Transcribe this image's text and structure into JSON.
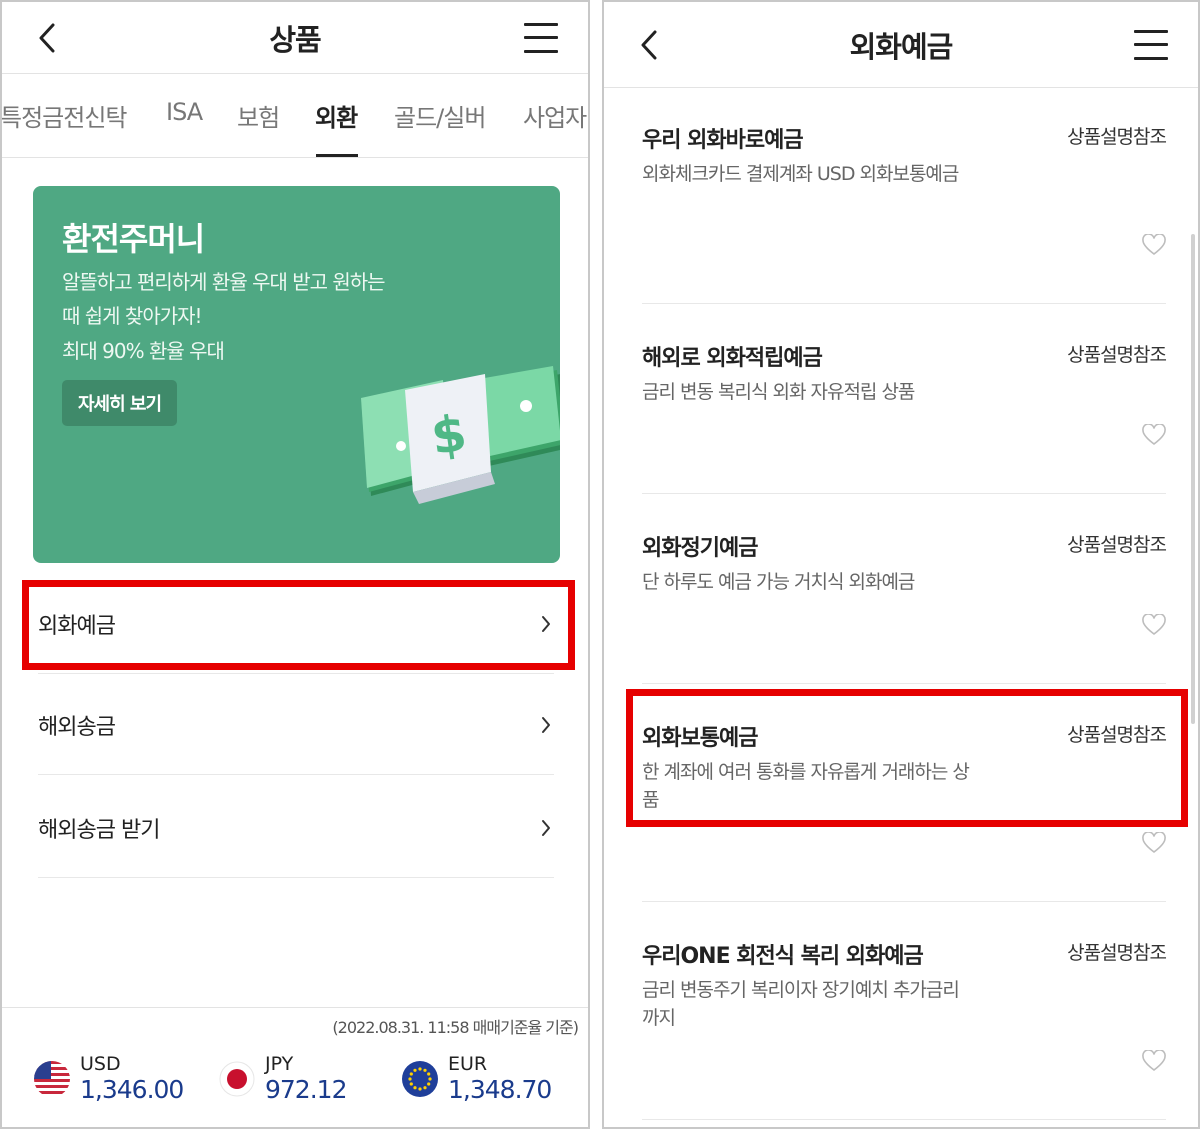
{
  "left": {
    "header": {
      "title": "상품"
    },
    "tabs": [
      {
        "label": "특정금전신탁",
        "active": false
      },
      {
        "label": "ISA",
        "active": false
      },
      {
        "label": "보험",
        "active": false
      },
      {
        "label": "외환",
        "active": true
      },
      {
        "label": "골드/실버",
        "active": false
      },
      {
        "label": "사업자",
        "active": false
      }
    ],
    "banner": {
      "title": "환전주머니",
      "desc": [
        "알뜰하고 편리하게 환율 우대 받고 원하는",
        "때 쉽게 찾아가자!",
        "최대 90% 환율 우대"
      ],
      "button_label": "자세히 보기",
      "background": "#4fa883",
      "illustration_icon": "dollar-money-stack-icon"
    },
    "menu": [
      {
        "label": "외화예금",
        "highlighted": true
      },
      {
        "label": "해외송금",
        "highlighted": false
      },
      {
        "label": "해외송금 받기",
        "highlighted": false
      }
    ],
    "rates": {
      "date_note": "(2022.08.31. 11:58 매매기준율 기준)",
      "items": [
        {
          "code": "USD",
          "value": "1,346.00",
          "flag_icon": "us-flag-icon"
        },
        {
          "code": "JPY",
          "value": "972.12",
          "flag_icon": "japan-flag-icon"
        },
        {
          "code": "EUR",
          "value": "1,348.70",
          "flag_icon": "eu-flag-icon"
        }
      ],
      "value_color": "#1a3b8c"
    }
  },
  "right": {
    "header": {
      "title": "외화예금"
    },
    "products": [
      {
        "name": "우리 외화바로예금",
        "ref": "상품설명참조",
        "desc": "외화체크카드 결제계좌 USD 외화보통예금",
        "highlighted": false
      },
      {
        "name": "해외로 외화적립예금",
        "ref": "상품설명참조",
        "desc": "금리 변동 복리식 외화 자유적립 상품",
        "highlighted": false
      },
      {
        "name": "외화정기예금",
        "ref": "상품설명참조",
        "desc": "단 하루도 예금 가능 거치식 외화예금",
        "highlighted": false
      },
      {
        "name": "외화보통예금",
        "ref": "상품설명참조",
        "desc": "한 계좌에 여러 통화를 자유롭게 거래하는 상품",
        "highlighted": true
      },
      {
        "name": "우리ONE 회전식 복리 외화예금",
        "ref": "상품설명참조",
        "desc": "금리 변동주기 복리이자 장기예치 추가금리까지",
        "highlighted": false
      }
    ]
  },
  "highlight_color": "#e60000"
}
